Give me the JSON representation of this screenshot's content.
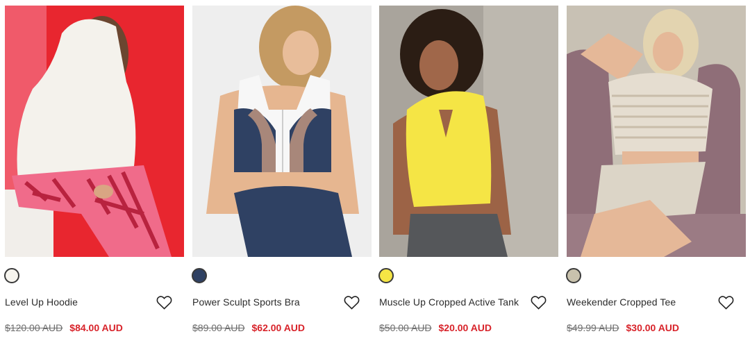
{
  "colors": {
    "sale": "#d8232a",
    "was": "#6d6d6d"
  },
  "products": [
    {
      "title": "Level Up Hoodie",
      "swatch_color": "#f7f5ef",
      "was_price": "$120.00 AUD",
      "now_price": "$84.00 AUD",
      "image_alt": "Woman in white hoodie and pink zebra print leggings"
    },
    {
      "title": "Power Sculpt Sports Bra",
      "swatch_color": "#2f4163",
      "was_price": "$89.00 AUD",
      "now_price": "$62.00 AUD",
      "image_alt": "Woman in navy, taupe and white sports bra"
    },
    {
      "title": "Muscle Up Cropped Active Tank",
      "swatch_color": "#f5e545",
      "was_price": "$50.00 AUD",
      "now_price": "$20.00 AUD",
      "image_alt": "Woman in yellow cropped tank"
    },
    {
      "title": "Weekender Cropped Tee",
      "swatch_color": "#c9c2ad",
      "was_price": "$49.99 AUD",
      "now_price": "$30.00 AUD",
      "image_alt": "Woman in striped cropped tee on a chair"
    }
  ]
}
